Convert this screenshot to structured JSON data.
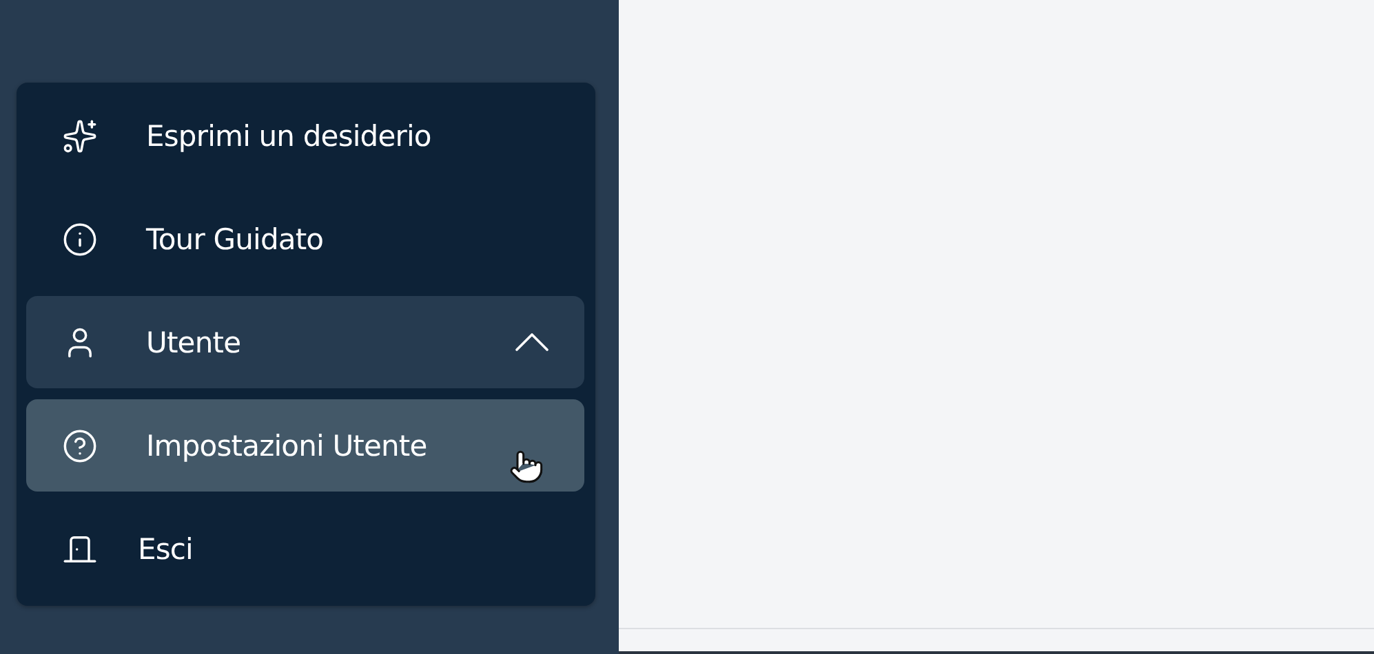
{
  "menu": {
    "items": [
      {
        "kind": "link",
        "label": "Esprimi un desiderio",
        "selected": false
      },
      {
        "kind": "link",
        "label": "Tour Guidato",
        "selected": false
      },
      {
        "kind": "group",
        "label": "Utente",
        "selected": false,
        "expanded": true,
        "children": [
          {
            "kind": "link",
            "label": "Impostazioni Utente",
            "selected": true
          }
        ]
      },
      {
        "kind": "link",
        "label": "Esci",
        "selected": false
      }
    ]
  }
}
